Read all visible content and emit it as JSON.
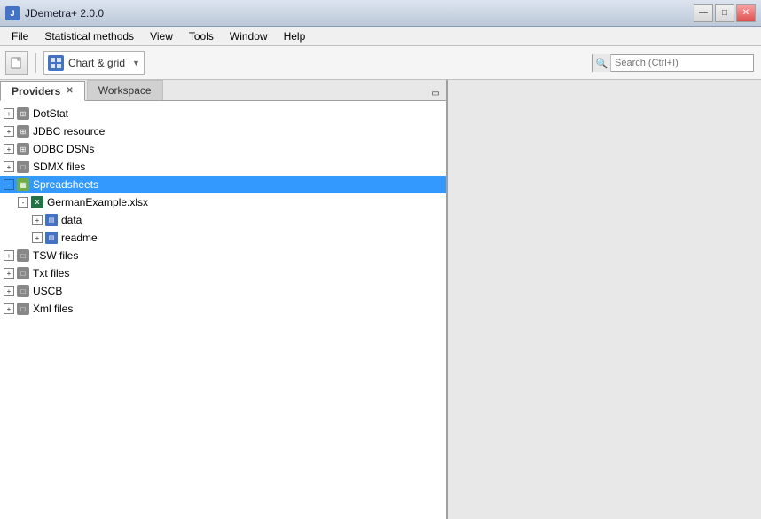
{
  "titleBar": {
    "appName": "JDemetra+ 2.0.0",
    "controls": {
      "minimize": "—",
      "maximize": "□",
      "close": "✕"
    }
  },
  "menuBar": {
    "items": [
      "File",
      "Statistical methods",
      "View",
      "Tools",
      "Window",
      "Help"
    ]
  },
  "searchBar": {
    "placeholder": "Search (Ctrl+I)"
  },
  "toolbar": {
    "dropdownLabel": "Chart & grid"
  },
  "tabs": {
    "providers": "Providers",
    "workspace": "Workspace"
  },
  "tree": {
    "nodes": [
      {
        "id": "dotstat",
        "label": "DotStat",
        "level": 0,
        "expandable": true,
        "expanded": false,
        "iconType": "db"
      },
      {
        "id": "jdbc",
        "label": "JDBC resource",
        "level": 0,
        "expandable": true,
        "expanded": false,
        "iconType": "db"
      },
      {
        "id": "odbc",
        "label": "ODBC DSNs",
        "level": 0,
        "expandable": true,
        "expanded": false,
        "iconType": "db"
      },
      {
        "id": "sdmx",
        "label": "SDMX files",
        "level": 0,
        "expandable": true,
        "expanded": false,
        "iconType": "folder"
      },
      {
        "id": "spreadsheets",
        "label": "Spreadsheets",
        "level": 0,
        "expandable": true,
        "expanded": true,
        "selected": true,
        "iconType": "grid"
      },
      {
        "id": "german",
        "label": "GermanExample.xlsx",
        "level": 1,
        "expandable": true,
        "expanded": true,
        "iconType": "xlsx"
      },
      {
        "id": "data",
        "label": "data",
        "level": 2,
        "expandable": true,
        "expanded": false,
        "iconType": "table"
      },
      {
        "id": "readme",
        "label": "readme",
        "level": 2,
        "expandable": true,
        "expanded": false,
        "iconType": "table"
      },
      {
        "id": "tsw",
        "label": "TSW files",
        "level": 0,
        "expandable": true,
        "expanded": false,
        "iconType": "folder"
      },
      {
        "id": "txt",
        "label": "Txt files",
        "level": 0,
        "expandable": true,
        "expanded": false,
        "iconType": "folder"
      },
      {
        "id": "uscb",
        "label": "USCB",
        "level": 0,
        "expandable": true,
        "expanded": false,
        "iconType": "folder"
      },
      {
        "id": "xml",
        "label": "Xml files",
        "level": 0,
        "expandable": true,
        "expanded": false,
        "iconType": "folder"
      }
    ]
  }
}
